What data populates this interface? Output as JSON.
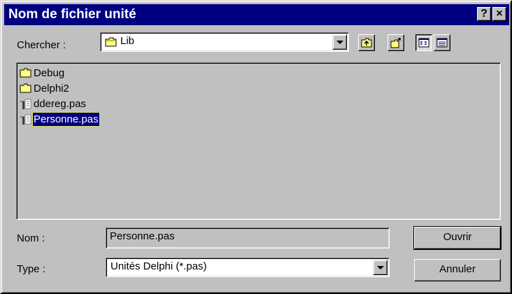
{
  "window": {
    "title": "Nom de fichier unité",
    "help_label": "?",
    "close_label": "×"
  },
  "lookin": {
    "label": "Chercher :",
    "value": "Lib",
    "folder_icon": "folder-icon"
  },
  "toolbar": {
    "buttons": [
      "up-one-level-icon",
      "new-folder-icon",
      "list-view-icon",
      "details-view-icon"
    ]
  },
  "files": [
    {
      "name": "Debug",
      "type": "folder"
    },
    {
      "name": "Delphi2",
      "type": "folder"
    },
    {
      "name": "ddereg.pas",
      "type": "pascal-unit"
    },
    {
      "name": "Personne.pas",
      "type": "pascal-unit",
      "selected": true
    }
  ],
  "filename": {
    "label": "Nom :",
    "value": "Personne.pas"
  },
  "filetype": {
    "label": "Type :",
    "value": "Unités Delphi (*.pas)"
  },
  "actions": {
    "open_label": "Ouvrir",
    "cancel_label": "Annuler"
  },
  "colors": {
    "titlebar": "#000080",
    "face": "#c0c0c0",
    "selection": "#000080"
  }
}
